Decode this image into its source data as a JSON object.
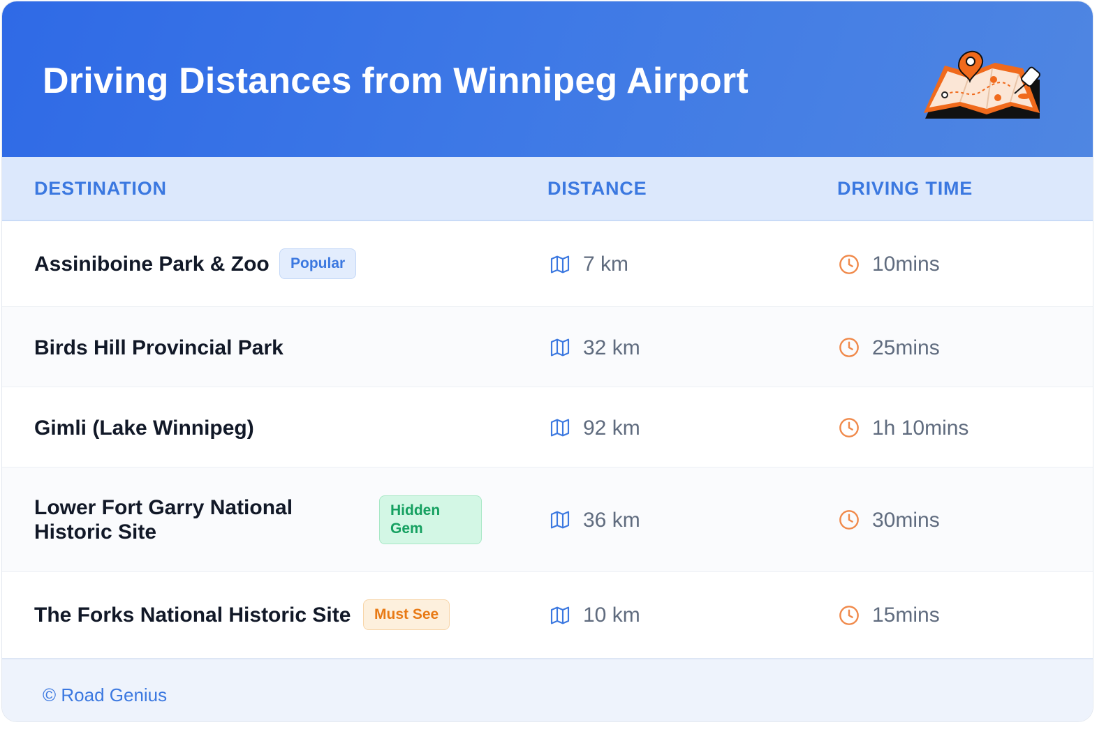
{
  "header": {
    "title": "Driving Distances from Winnipeg Airport",
    "illustration": "folded-map-with-pins-icon",
    "gradient_colors": [
      "#2f6ae6",
      "#4f86e2"
    ]
  },
  "table": {
    "columns": [
      "DESTINATION",
      "DISTANCE",
      "DRIVING TIME"
    ],
    "distance_icon": "map-icon",
    "time_icon": "clock-icon",
    "rows": [
      {
        "destination": "Assiniboine Park & Zoo",
        "badge": "Popular",
        "distance": "7 km",
        "time": "10mins"
      },
      {
        "destination": "Birds Hill Provincial Park",
        "badge": "",
        "distance": "32 km",
        "time": "25mins"
      },
      {
        "destination": "Gimli (Lake Winnipeg)",
        "badge": "",
        "distance": "92 km",
        "time": "1h 10mins"
      },
      {
        "destination": "Lower Fort Garry National Historic Site",
        "badge": "Hidden Gem",
        "distance": "36 km",
        "time": "30mins"
      },
      {
        "destination": "The Forks National Historic Site",
        "badge": "Must See",
        "distance": "10 km",
        "time": "15mins"
      }
    ]
  },
  "footer": {
    "credit": "© Road Genius"
  },
  "colors": {
    "accent_blue": "#3b78e0",
    "clock_orange": "#f0894a",
    "badge_popular": "#3b78e0",
    "badge_hidden_gem": "#15a060",
    "badge_must_see": "#e87a15"
  }
}
